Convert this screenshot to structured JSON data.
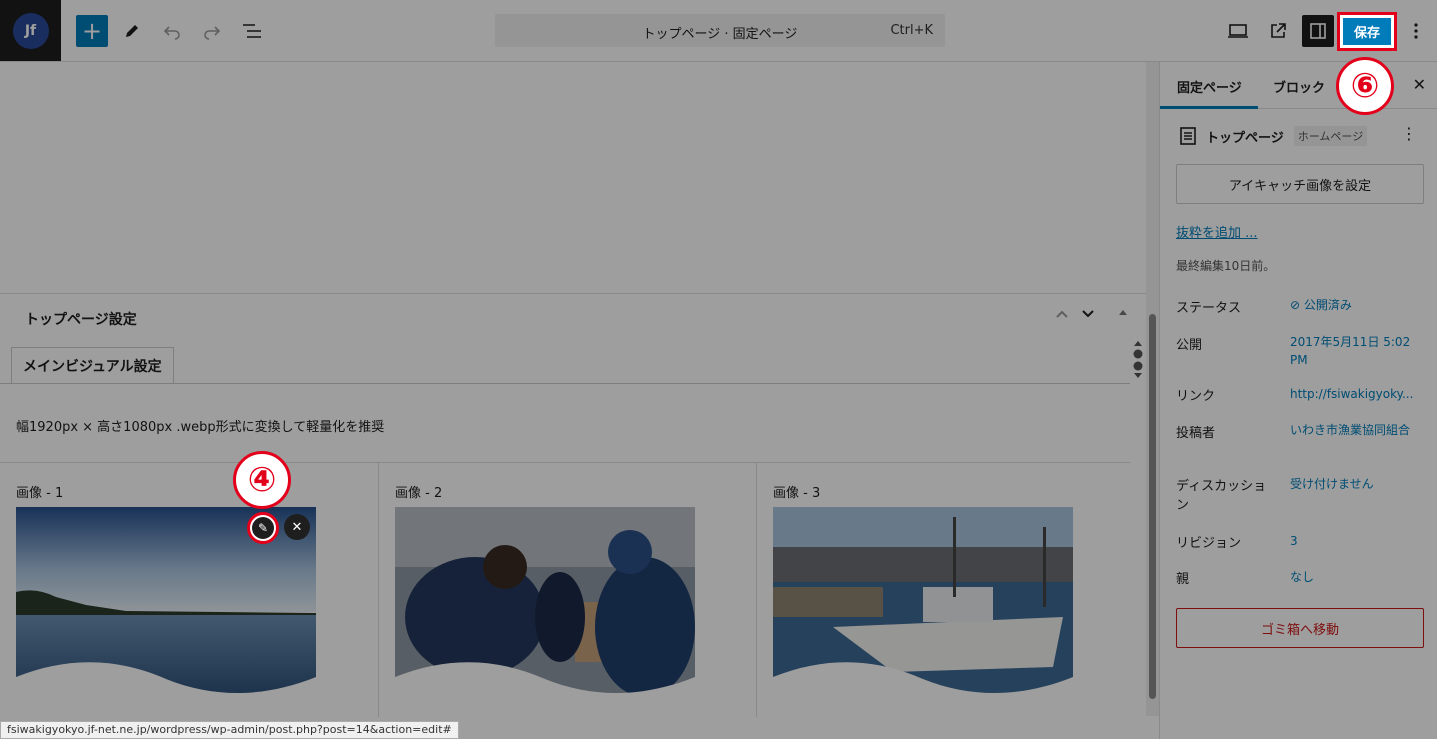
{
  "header": {
    "logo": "Jf",
    "add_label": "+",
    "command_title": "トップページ · 固定ページ",
    "command_shortcut": "Ctrl+K",
    "save_label": "保存"
  },
  "metabox": {
    "title": "トップページ設定",
    "tab": "メインビジュアル設定",
    "description": "幅1920px × 高さ1080px .webp形式に変換して軽量化を推奨",
    "columns": [
      {
        "label": "画像 - 1"
      },
      {
        "label": "画像 - 2"
      },
      {
        "label": "画像 - 3"
      }
    ]
  },
  "sidebar": {
    "tab_page": "固定ページ",
    "tab_block": "ブロック",
    "page_title": "トップページ",
    "page_badge": "ホームページ",
    "featured_image": "アイキャッチ画像を設定",
    "excerpt": "抜粋を追加 ...",
    "last_edited": "最終編集10日前。",
    "rows": [
      {
        "label": "ステータス",
        "value": "公開済み"
      },
      {
        "label": "公開",
        "value": "2017年5月11日 5:02 PM"
      },
      {
        "label": "リンク",
        "value": "http://fsiwakigyoky..."
      },
      {
        "label": "投稿者",
        "value": "いわき市漁業協同組合"
      },
      {
        "label": "ディスカッション",
        "value": "受け付けません"
      },
      {
        "label": "リビジョン",
        "value": "3"
      },
      {
        "label": "親",
        "value": "なし"
      }
    ],
    "trash": "ゴミ箱へ移動"
  },
  "markers": {
    "four": "④",
    "six": "⑥"
  },
  "status_url": "fsiwakigyokyo.jf-net.ne.jp/wordpress/wp-admin/post.php?post=14&action=edit#",
  "colors": {
    "accent": "#007cba",
    "highlight": "#e3001b",
    "danger": "#cc1818"
  }
}
